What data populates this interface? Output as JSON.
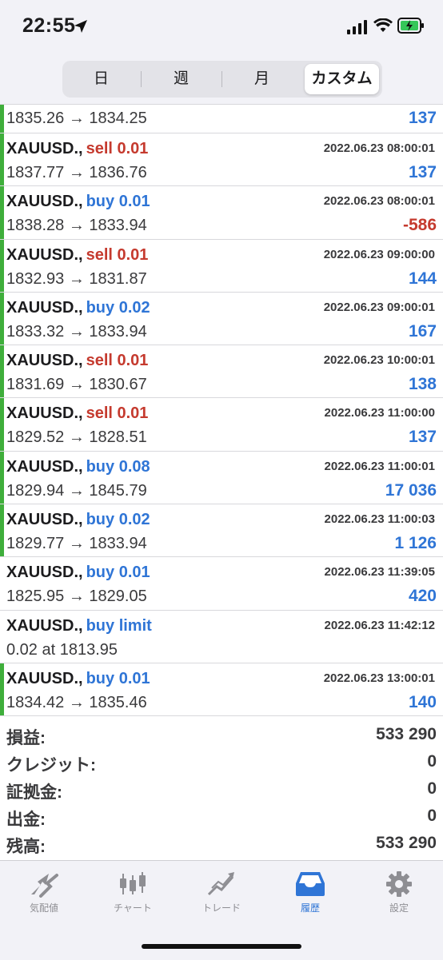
{
  "status": {
    "time": "22:55"
  },
  "periods": [
    "日",
    "週",
    "月",
    "カスタム"
  ],
  "first": {
    "prices": "1835.26 → 1834.25",
    "profit": "137"
  },
  "trades": [
    {
      "symbol": "XAUUSD.,",
      "dir": "sell 0.01",
      "time": "2022.06.23 08:00:01",
      "prices": "1837.77 → 1836.76",
      "profit": "137",
      "bar": true
    },
    {
      "symbol": "XAUUSD.,",
      "dir": "buy 0.01",
      "time": "2022.06.23 08:00:01",
      "prices": "1838.28 → 1833.94",
      "profit": "-586",
      "bar": true
    },
    {
      "symbol": "XAUUSD.,",
      "dir": "sell 0.01",
      "time": "2022.06.23 09:00:00",
      "prices": "1832.93 → 1831.87",
      "profit": "144",
      "bar": true
    },
    {
      "symbol": "XAUUSD.,",
      "dir": "buy 0.02",
      "time": "2022.06.23 09:00:01",
      "prices": "1833.32 → 1833.94",
      "profit": "167",
      "bar": true
    },
    {
      "symbol": "XAUUSD.,",
      "dir": "sell 0.01",
      "time": "2022.06.23 10:00:01",
      "prices": "1831.69 → 1830.67",
      "profit": "138",
      "bar": true
    },
    {
      "symbol": "XAUUSD.,",
      "dir": "sell 0.01",
      "time": "2022.06.23 11:00:00",
      "prices": "1829.52 → 1828.51",
      "profit": "137",
      "bar": true
    },
    {
      "symbol": "XAUUSD.,",
      "dir": "buy 0.08",
      "time": "2022.06.23 11:00:01",
      "prices": "1829.94 → 1845.79",
      "profit": "17 036",
      "bar": true
    },
    {
      "symbol": "XAUUSD.,",
      "dir": "buy 0.02",
      "time": "2022.06.23 11:00:03",
      "prices": "1829.77 → 1833.94",
      "profit": "1 126",
      "bar": true
    },
    {
      "symbol": "XAUUSD.,",
      "dir": "buy 0.01",
      "time": "2022.06.23 11:39:05",
      "prices": "1825.95 → 1829.05",
      "profit": "420",
      "bar": false
    },
    {
      "symbol": "XAUUSD.,",
      "dir": "buy limit",
      "time": "2022.06.23 11:42:12",
      "prices": "0.02 at 1813.95",
      "profit": "",
      "bar": false
    },
    {
      "symbol": "XAUUSD.,",
      "dir": "buy 0.01",
      "time": "2022.06.23 13:00:01",
      "prices": "1834.42 → 1835.46",
      "profit": "140",
      "bar": true
    }
  ],
  "summary": [
    {
      "label": "損益:",
      "value": "533 290"
    },
    {
      "label": "クレジット:",
      "value": "0"
    },
    {
      "label": "証拠金:",
      "value": "0"
    },
    {
      "label": "出金:",
      "value": "0"
    },
    {
      "label": "残高:",
      "value": "533 290"
    }
  ],
  "tabs": [
    {
      "label": "気配値",
      "icon": "quotes-icon"
    },
    {
      "label": "チャート",
      "icon": "chart-icon"
    },
    {
      "label": "トレード",
      "icon": "trade-icon"
    },
    {
      "label": "履歴",
      "icon": "history-icon"
    },
    {
      "label": "設定",
      "icon": "settings-icon"
    }
  ],
  "colors": {
    "sell": "#c53a2e",
    "buy": "#2f75d6",
    "active_tab": "#2f75d6",
    "bar": "#3fae3b"
  }
}
